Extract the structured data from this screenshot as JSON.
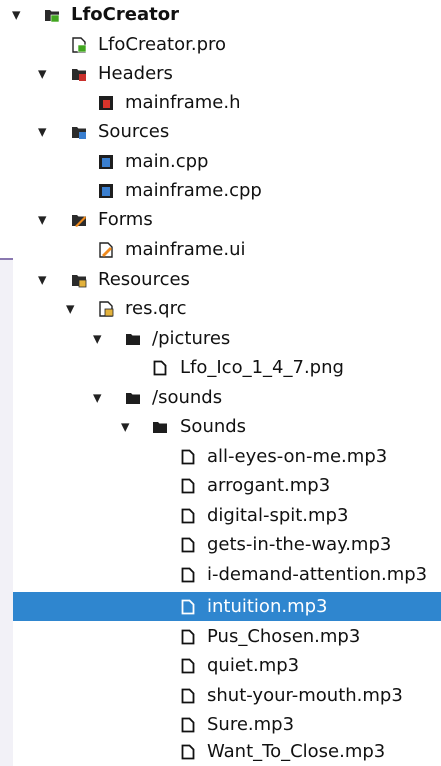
{
  "tree": {
    "root": {
      "label": "LfoCreator",
      "icon": "qt-project-folder-icon"
    },
    "items": [
      {
        "label": "LfoCreator.pro",
        "icon": "project-file-icon"
      },
      {
        "label": "Headers",
        "icon": "headers-folder-icon"
      },
      {
        "label": "mainframe.h",
        "icon": "header-file-icon"
      },
      {
        "label": "Sources",
        "icon": "sources-folder-icon"
      },
      {
        "label": "main.cpp",
        "icon": "cpp-file-icon"
      },
      {
        "label": "mainframe.cpp",
        "icon": "cpp-file-icon"
      },
      {
        "label": "Forms",
        "icon": "forms-folder-icon"
      },
      {
        "label": "mainframe.ui",
        "icon": "ui-file-icon"
      },
      {
        "label": "Resources",
        "icon": "resources-folder-icon"
      },
      {
        "label": "res.qrc",
        "icon": "qrc-file-icon"
      },
      {
        "label": "/pictures",
        "icon": "folder-icon"
      },
      {
        "label": "Lfo_Ico_1_4_7.png",
        "icon": "file-icon"
      },
      {
        "label": "/sounds",
        "icon": "folder-icon"
      },
      {
        "label": "Sounds",
        "icon": "folder-icon"
      },
      {
        "label": "all-eyes-on-me.mp3",
        "icon": "file-icon"
      },
      {
        "label": "arrogant.mp3",
        "icon": "file-icon"
      },
      {
        "label": "digital-spit.mp3",
        "icon": "file-icon"
      },
      {
        "label": "gets-in-the-way.mp3",
        "icon": "file-icon"
      },
      {
        "label": "i-demand-attention.mp3",
        "icon": "file-icon"
      },
      {
        "label": "intuition.mp3",
        "icon": "file-icon",
        "selected": true
      },
      {
        "label": "Pus_Chosen.mp3",
        "icon": "file-icon"
      },
      {
        "label": "quiet.mp3",
        "icon": "file-icon"
      },
      {
        "label": "shut-your-mouth.mp3",
        "icon": "file-icon"
      },
      {
        "label": "Sure.mp3",
        "icon": "file-icon"
      },
      {
        "label": "Want_To_Close.mp3",
        "icon": "file-icon"
      }
    ]
  },
  "colors": {
    "selection": "#2f86cf",
    "selection_text": "#ffffff",
    "accent_line": "#8a78b0"
  }
}
